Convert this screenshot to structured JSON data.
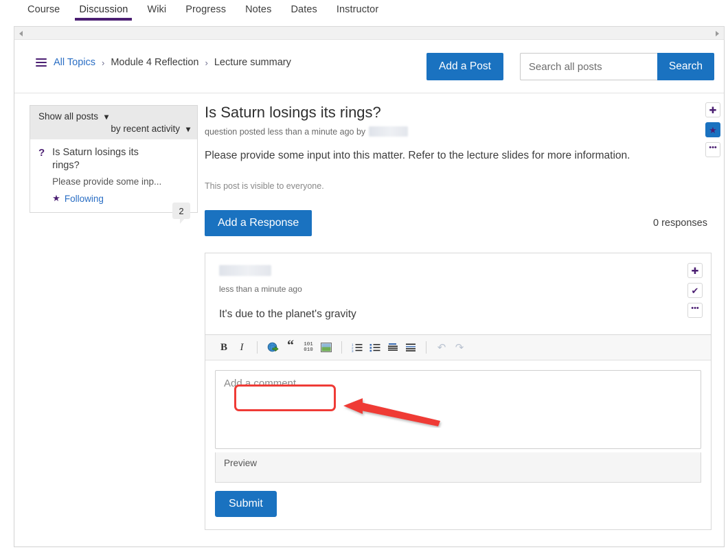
{
  "tabs": [
    {
      "label": "Course",
      "active": false
    },
    {
      "label": "Discussion",
      "active": true
    },
    {
      "label": "Wiki",
      "active": false
    },
    {
      "label": "Progress",
      "active": false
    },
    {
      "label": "Notes",
      "active": false
    },
    {
      "label": "Dates",
      "active": false
    },
    {
      "label": "Instructor",
      "active": false
    }
  ],
  "header": {
    "breadcrumb": {
      "menu_icon": "hamburger-icon",
      "all_topics": "All Topics",
      "separator": "›",
      "module": "Module 4 Reflection",
      "current": "Lecture summary"
    },
    "add_post_label": "Add a Post",
    "search_placeholder": "Search all posts",
    "search_value": "",
    "search_button_label": "Search"
  },
  "sidebar": {
    "filter_label": "Show all posts",
    "sort_label": "by recent activity",
    "caret_icon": "chevron-down-icon",
    "post": {
      "type_icon": "question-mark-icon",
      "title": "Is Saturn losings its rings?",
      "snippet": "Please provide some inp...",
      "following_label": "Following",
      "star_icon": "star-icon",
      "comment_count": "2"
    }
  },
  "post": {
    "title": "Is Saturn losings its rings?",
    "meta_prefix": "question posted less than a minute ago by",
    "author": "",
    "body": "Please provide some input into this matter. Refer to the lecture slides for more information.",
    "visibility": "This post is visible to everyone.",
    "actions": [
      {
        "icon": "plus-icon",
        "glyph": "✚",
        "filled": false
      },
      {
        "icon": "star-icon",
        "glyph": "★",
        "filled": true
      },
      {
        "icon": "more-options-icon",
        "glyph": "•••",
        "filled": false
      }
    ]
  },
  "responses": {
    "add_response_label": "Add a Response",
    "count_label": "0 responses",
    "items": [
      {
        "author": "",
        "time": "less than a minute ago",
        "text": "It's due to the planet's gravity",
        "actions": [
          {
            "icon": "plus-icon",
            "glyph": "✚"
          },
          {
            "icon": "check-icon",
            "glyph": "✔"
          },
          {
            "icon": "more-options-icon",
            "glyph": "•••"
          }
        ]
      }
    ]
  },
  "editor": {
    "toolbar": [
      {
        "name": "bold-icon",
        "label": "B"
      },
      {
        "name": "italic-icon",
        "label": "I"
      },
      {
        "name": "insert-link-icon",
        "label": ""
      },
      {
        "name": "blockquote-icon",
        "label": "“"
      },
      {
        "name": "code-block-icon",
        "label": "101 010"
      },
      {
        "name": "insert-image-icon",
        "label": ""
      },
      {
        "name": "numbered-list-icon",
        "label": ""
      },
      {
        "name": "bullet-list-icon",
        "label": ""
      },
      {
        "name": "align-left-icon",
        "label": ""
      },
      {
        "name": "align-justify-icon",
        "label": ""
      },
      {
        "name": "undo-icon",
        "label": "↶"
      },
      {
        "name": "redo-icon",
        "label": "↷"
      }
    ],
    "comment_placeholder": "Add a comment",
    "comment_value": "",
    "preview_label": "Preview",
    "submit_label": "Submit"
  },
  "scrollbar": {
    "left_arrow": "scroll-left-arrow",
    "right_arrow": "scroll-right-arrow"
  },
  "colors": {
    "primary_blue": "#1a72c0",
    "brand_purple": "#4b1f72",
    "link_blue": "#2a6ec4",
    "annotation_red": "#ef3b36"
  }
}
